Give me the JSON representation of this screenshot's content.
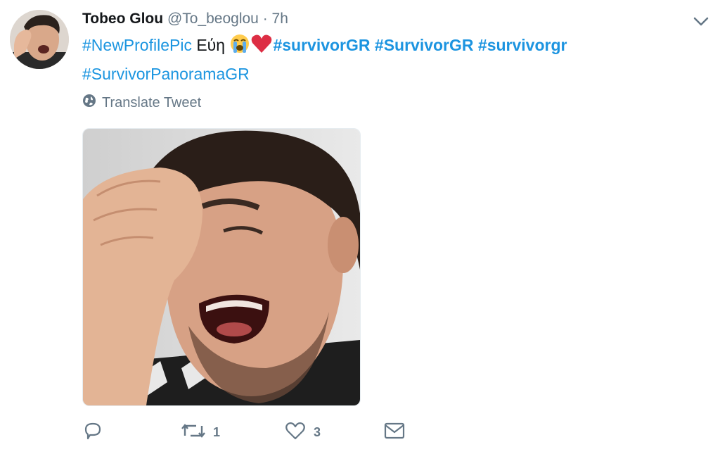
{
  "tweet": {
    "display_name": "Tobeo Glou",
    "handle": "@To_beoglou",
    "separator": "·",
    "time": "7h",
    "text_parts": {
      "tag1": "#NewProfilePic",
      "word": "Εύη",
      "tag2": "#survivorGR",
      "tag3": "#SurvivorGR",
      "tag4": "#survivorgr",
      "tag5": "#SurvivorPanoramaGR"
    },
    "translate_label": "Translate Tweet",
    "stats": {
      "retweets": "1",
      "likes": "3"
    }
  },
  "colors": {
    "link": "#1b95e0",
    "muted": "#657786",
    "heart": "#e0245e"
  },
  "icons": {
    "caret": "chevron-down-icon",
    "globe": "globe-icon",
    "reply": "reply-icon",
    "retweet": "retweet-icon",
    "like": "heart-icon",
    "dm": "envelope-icon",
    "emoji1": "loudly-crying-face-emoji",
    "emoji2": "red-heart-emoji"
  }
}
